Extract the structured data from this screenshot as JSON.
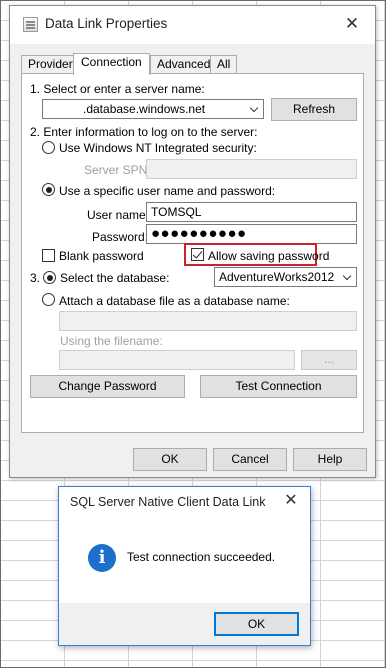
{
  "dialog": {
    "title": "Data Link Properties",
    "tabs": [
      "Provider",
      "Connection",
      "Advanced",
      "All"
    ],
    "active_tab": "Connection"
  },
  "connection": {
    "step1_label": "1. Select or enter a server name:",
    "server_name": ".database.windows.net",
    "refresh_button": "Refresh",
    "step2_label": "2. Enter information to log on to the server:",
    "windows_nt_label": "Use Windows NT Integrated security:",
    "server_spn_label": "Server SPN:",
    "server_spn_value": "",
    "specific_user_label": "Use a specific user name and password:",
    "user_name_label": "User name:",
    "user_name_value": "TOMSQL",
    "password_label": "Password:",
    "password_value": "●●●●●●●●●●",
    "blank_password_label": "Blank password",
    "allow_saving_label": "Allow saving password",
    "step3_number": "3.",
    "select_db_label": "Select the database:",
    "database_value": "AdventureWorks2012",
    "attach_db_label": "Attach a database file as a database name:",
    "attach_db_value": "",
    "using_filename_label": "Using the filename:",
    "filename_value": "",
    "browse_button": "...",
    "change_password_button": "Change Password",
    "test_connection_button": "Test Connection"
  },
  "footer": {
    "ok": "OK",
    "cancel": "Cancel",
    "help": "Help"
  },
  "message": {
    "title": "SQL Server Native Client Data Link",
    "text": "Test connection succeeded.",
    "ok": "OK",
    "icon": "information-icon"
  },
  "state": {
    "windows_nt_selected": false,
    "specific_user_selected": true,
    "blank_password_checked": false,
    "allow_saving_checked": true,
    "select_database_selected": true,
    "attach_database_selected": false
  },
  "colors": {
    "highlight": "#cc2229",
    "info_icon": "#1d6fc9",
    "focus": "#0078d7"
  }
}
